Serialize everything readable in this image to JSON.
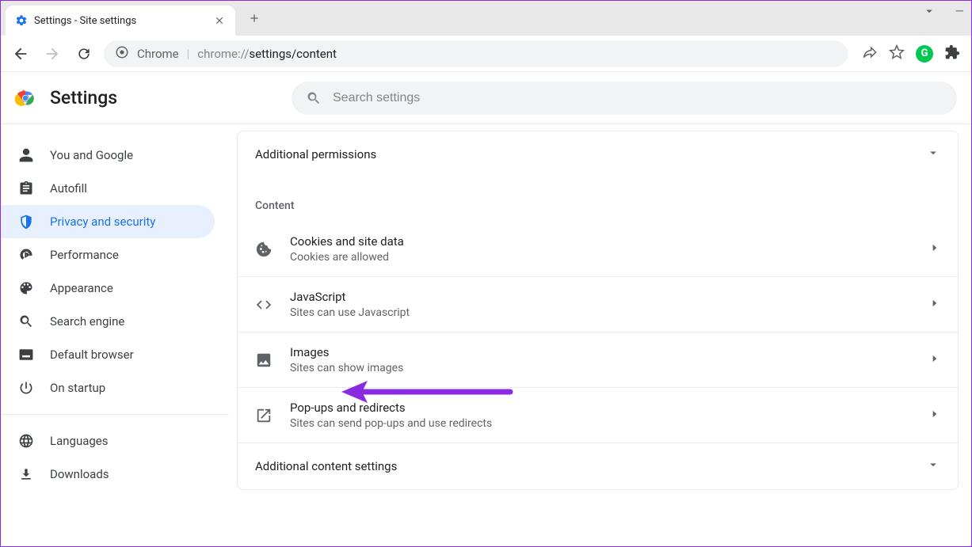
{
  "browser": {
    "tab_title": "Settings - Site settings",
    "url_host": "Chrome",
    "url_path_prefix": "chrome://",
    "url_path_bold": "settings/content"
  },
  "header": {
    "app_title": "Settings",
    "search_placeholder": "Search settings"
  },
  "sidebar": {
    "items": [
      {
        "id": "you-and-google",
        "label": "You and Google"
      },
      {
        "id": "autofill",
        "label": "Autofill"
      },
      {
        "id": "privacy",
        "label": "Privacy and security"
      },
      {
        "id": "performance",
        "label": "Performance"
      },
      {
        "id": "appearance",
        "label": "Appearance"
      },
      {
        "id": "search-engine",
        "label": "Search engine"
      },
      {
        "id": "default-browser",
        "label": "Default browser"
      },
      {
        "id": "on-startup",
        "label": "On startup"
      },
      {
        "id": "languages",
        "label": "Languages"
      },
      {
        "id": "downloads",
        "label": "Downloads"
      }
    ]
  },
  "main": {
    "additional_permissions": "Additional permissions",
    "content_section_label": "Content",
    "items": {
      "cookies": {
        "title": "Cookies and site data",
        "sub": "Cookies are allowed"
      },
      "javascript": {
        "title": "JavaScript",
        "sub": "Sites can use Javascript"
      },
      "images": {
        "title": "Images",
        "sub": "Sites can show images"
      },
      "popups": {
        "title": "Pop-ups and redirects",
        "sub": "Sites can send pop-ups and use redirects"
      }
    },
    "additional_content": "Additional content settings"
  }
}
